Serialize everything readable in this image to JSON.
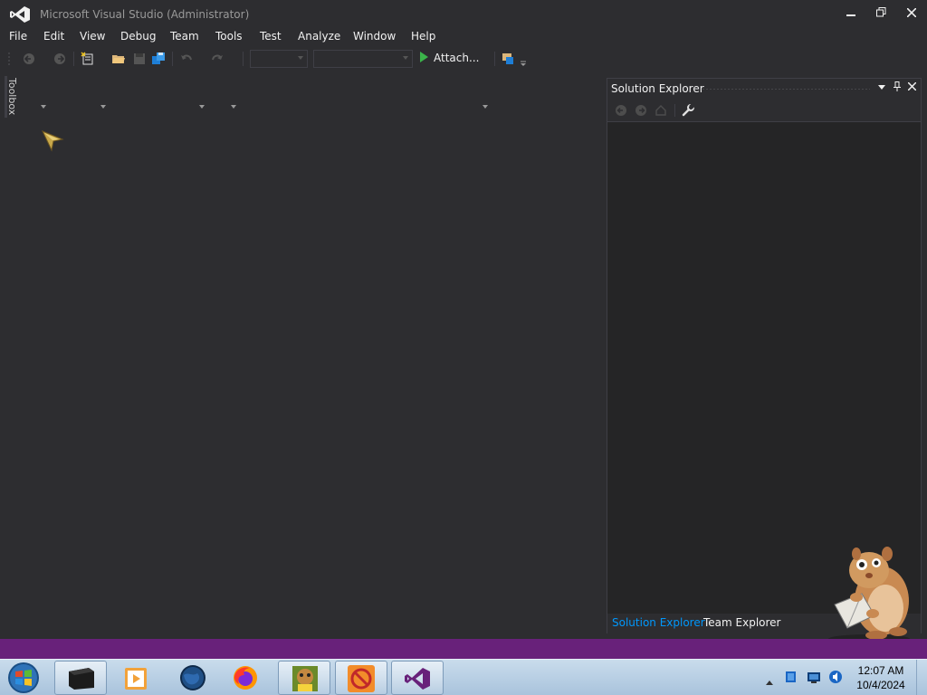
{
  "window": {
    "title": "Microsoft Visual Studio (Administrator)",
    "controls": {
      "minimize": "minimize-icon",
      "maximize": "restore-icon",
      "close": "close-icon"
    }
  },
  "menu": {
    "items": [
      "File",
      "Edit",
      "View",
      "Debug",
      "Team",
      "Tools",
      "Test",
      "Analyze",
      "Window",
      "Help"
    ]
  },
  "toolbar": {
    "attach_label": "Attach...",
    "config_combo_value": "",
    "platform_combo_value": ""
  },
  "toolbox": {
    "label": "Toolbox"
  },
  "solution_explorer": {
    "title": "Solution Explorer",
    "tabs": [
      "Solution Explorer",
      "Team Explorer"
    ],
    "active_tab": "Solution Explorer"
  },
  "taskbar": {
    "apps": [
      "start-orb",
      "terminal",
      "media-player",
      "globe-app",
      "firefox",
      "sandboxie",
      "no-symbol-app",
      "visual-studio"
    ],
    "time": "12:07 AM",
    "date": "10/4/2024"
  },
  "colors": {
    "background": "#2d2d30",
    "status_bar": "#68217a",
    "vs_purple": "#68217a",
    "active_tab": "#0097fb",
    "play_green": "#3bb44a"
  }
}
